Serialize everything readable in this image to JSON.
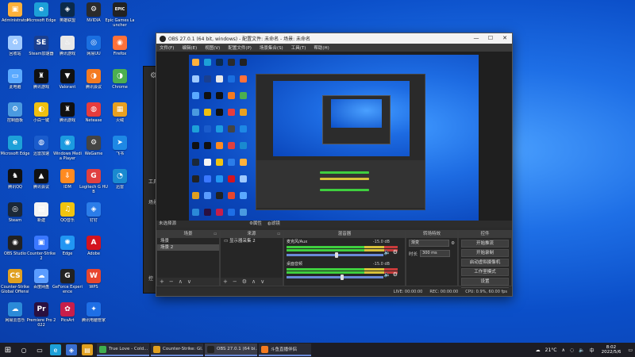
{
  "desktop": {
    "icons": [
      {
        "label": "Administrator",
        "color": "#ffb13b",
        "glyph": "▣",
        "col": 0,
        "row": 0
      },
      {
        "label": "回收站",
        "color": "#9ec9ff",
        "glyph": "♻",
        "col": 0,
        "row": 1
      },
      {
        "label": "此电脑",
        "color": "#5aa9ff",
        "glyph": "▭",
        "col": 0,
        "row": 2
      },
      {
        "label": "控制面板",
        "color": "#4a9ae0",
        "glyph": "⚙",
        "col": 0,
        "row": 3
      },
      {
        "label": "Microsoft Edge",
        "color": "#1da0d8",
        "glyph": "e",
        "col": 0,
        "row": 4
      },
      {
        "label": "腾讯QQ",
        "color": "#111111",
        "glyph": "♞",
        "col": 0,
        "row": 5
      },
      {
        "label": "Steam",
        "color": "#1b2838",
        "glyph": "◎",
        "col": 0,
        "row": 6
      },
      {
        "label": "OBS Studio",
        "color": "#222222",
        "glyph": "◉",
        "col": 0,
        "row": 7
      },
      {
        "label": "Counter-Strike Global Offensive",
        "color": "#e0a020",
        "glyph": "CS",
        "col": 0,
        "row": 8
      },
      {
        "label": "网易云音乐",
        "color": "#2b8ad8",
        "glyph": "☁",
        "col": 0,
        "row": 9
      },
      {
        "label": "Microsoft Edge",
        "color": "#1da0d8",
        "glyph": "e",
        "col": 1,
        "row": 0
      },
      {
        "label": "Steam加速器",
        "color": "#1a3f8f",
        "glyph": "SE",
        "col": 1,
        "row": 1
      },
      {
        "label": "腾讯游戏",
        "color": "#111111",
        "glyph": "♜",
        "col": 1,
        "row": 2
      },
      {
        "label": "小白一键",
        "color": "#f0c010",
        "glyph": "◐",
        "col": 1,
        "row": 3
      },
      {
        "label": "迅雷加速",
        "color": "#1a5ccc",
        "glyph": "◍",
        "col": 1,
        "row": 4
      },
      {
        "label": "腾讯会议",
        "color": "#111111",
        "glyph": "▲",
        "col": 1,
        "row": 5
      },
      {
        "label": "新建",
        "color": "#f4f4f4",
        "glyph": "▤",
        "col": 1,
        "row": 6
      },
      {
        "label": "Counter-Strike 2",
        "color": "#3a78ff",
        "glyph": "▣",
        "col": 1,
        "row": 7
      },
      {
        "label": "百度网盘",
        "color": "#5a9cff",
        "glyph": "☁",
        "col": 1,
        "row": 8
      },
      {
        "label": "Premiere Pro 2022",
        "color": "#2a1040",
        "glyph": "Pr",
        "col": 1,
        "row": 9
      },
      {
        "label": "英雄联盟",
        "color": "#0b2a4a",
        "glyph": "◈",
        "col": 2,
        "row": 0
      },
      {
        "label": "腾讯游戏",
        "color": "#e8e8e8",
        "glyph": "♨",
        "col": 2,
        "row": 1
      },
      {
        "label": "Valorant",
        "color": "#111111",
        "glyph": "▼",
        "col": 2,
        "row": 2
      },
      {
        "label": "腾讯游戏",
        "color": "#111111",
        "glyph": "♜",
        "col": 2,
        "row": 3
      },
      {
        "label": "Windows Media Player",
        "color": "#1c9be0",
        "glyph": "◉",
        "col": 2,
        "row": 4
      },
      {
        "label": "IDM",
        "color": "#ff8a20",
        "glyph": "⇩",
        "col": 2,
        "row": 5
      },
      {
        "label": "QQ音乐",
        "color": "#f1c40f",
        "glyph": "♫",
        "col": 2,
        "row": 6
      },
      {
        "label": "Edge",
        "color": "#2196f3",
        "glyph": "✺",
        "col": 2,
        "row": 7
      },
      {
        "label": "GeForce Experience",
        "color": "#222222",
        "glyph": "G",
        "col": 2,
        "row": 8
      },
      {
        "label": "PicsArt",
        "color": "#c81e4a",
        "glyph": "✿",
        "col": 2,
        "row": 9
      },
      {
        "label": "NVIDIA",
        "color": "#2b2b2b",
        "glyph": "⚙",
        "col": 3,
        "row": 0
      },
      {
        "label": "网易UU",
        "color": "#1a6fe0",
        "glyph": "◎",
        "col": 3,
        "row": 1
      },
      {
        "label": "腾讯会议",
        "color": "#f47a20",
        "glyph": "◑",
        "col": 3,
        "row": 2
      },
      {
        "label": "Netease",
        "color": "#e73c3c",
        "glyph": "◍",
        "col": 3,
        "row": 3
      },
      {
        "label": "WeGame",
        "color": "#444444",
        "glyph": "⚙",
        "col": 3,
        "row": 4
      },
      {
        "label": "Logitech G HUB",
        "color": "#e04040",
        "glyph": "G",
        "col": 3,
        "row": 5
      },
      {
        "label": "钉钉",
        "color": "#2b7de9",
        "glyph": "◈",
        "col": 3,
        "row": 6
      },
      {
        "label": "Adobe",
        "color": "#d4131f",
        "glyph": "A",
        "col": 3,
        "row": 7
      },
      {
        "label": "WPS",
        "color": "#e8462e",
        "glyph": "W",
        "col": 3,
        "row": 8
      },
      {
        "label": "腾讯电脑管家",
        "color": "#1e6fe6",
        "glyph": "✦",
        "col": 3,
        "row": 9
      },
      {
        "label": "Epic Games Launcher",
        "color": "#222222",
        "glyph": "EPIC",
        "col": 4,
        "row": 0
      },
      {
        "label": "Firefox",
        "color": "#ff7139",
        "glyph": "◉",
        "col": 4,
        "row": 1
      },
      {
        "label": "Chrome",
        "color": "#4caf50",
        "glyph": "◑",
        "col": 4,
        "row": 2
      },
      {
        "label": "火绒",
        "color": "#e8a020",
        "glyph": "▦",
        "col": 4,
        "row": 3
      },
      {
        "label": "飞书",
        "color": "#1e88e5",
        "glyph": "➤",
        "col": 4,
        "row": 4
      },
      {
        "label": "迅雷",
        "color": "#1a8ad0",
        "glyph": "◔",
        "col": 4,
        "row": 5
      }
    ]
  },
  "bg_window": {
    "gear": "⚙",
    "text1": "工具",
    "text2": "场景",
    "text3": "控"
  },
  "obs": {
    "title": "OBS 27.0.1 (64 bit, windows) - 配置文件: 未命名 - 场景: 未命名",
    "menu": [
      "文件(F)",
      "编辑(E)",
      "视图(V)",
      "配置文件(P)",
      "场景集合(S)",
      "工具(T)",
      "帮助(H)"
    ],
    "window_controls": [
      "—",
      "☐",
      "✕"
    ],
    "sources_bar": {
      "no_source": "未选择源",
      "properties": "⚙属性",
      "filters": "◍滤镜"
    },
    "docks": {
      "scenes": {
        "title": "场景",
        "items": [
          "场景",
          "场景 2"
        ],
        "selected_index": 1
      },
      "sources": {
        "title": "来源",
        "items": [
          "显示器采集 2"
        ]
      },
      "mixer": {
        "title": "混音器",
        "tracks": [
          {
            "name": "麦克风/Aux",
            "db": "-15.0 dB",
            "level": 0.52
          },
          {
            "name": "桌面音频",
            "db": "-15.0 dB",
            "level": 0.58
          }
        ]
      },
      "transitions": {
        "title": "转场特效",
        "type": "渐变",
        "duration_label": "时长",
        "duration": "300 ms"
      },
      "controls": {
        "title": "控件",
        "buttons": [
          "开始推流",
          "开始录制",
          "启动虚拟摄像机",
          "工作室模式",
          "设置",
          "退出"
        ]
      }
    },
    "status": {
      "drop": "LIVE: 00:00:00",
      "rec": "REC: 00:00:00",
      "cpu": "CPU: 0.9%, 60.00 fps"
    }
  },
  "taskbar": {
    "tasks": [
      {
        "label": "True Love - Cold...",
        "color": "#3fae4f",
        "active": false
      },
      {
        "label": "Counter-Strike: Gl...",
        "color": "#e0a020",
        "active": false
      },
      {
        "label": "OBS 27.0.1 (64 bi...",
        "color": "#222222",
        "active": true
      },
      {
        "label": "斗鱼直播伴侣",
        "color": "#f47a20",
        "active": false
      }
    ],
    "weather": "21°C",
    "time": "8:02",
    "date": "2022/5/6"
  }
}
